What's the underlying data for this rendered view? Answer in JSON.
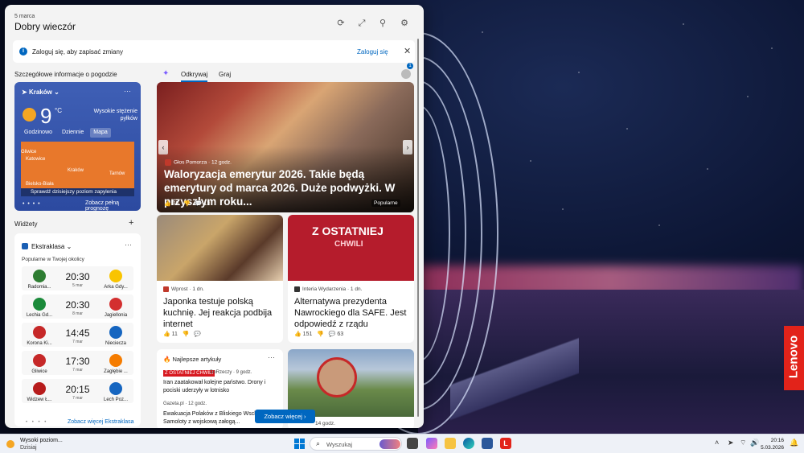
{
  "header": {
    "date": "5 marca",
    "greeting": "Dobry wieczór",
    "icons": [
      "refresh-icon",
      "expand-icon",
      "pin-icon",
      "settings-icon"
    ]
  },
  "signin_bar": {
    "message": "Zaloguj się, aby zapisać zmiany",
    "link": "Zaloguj się",
    "close": "✕"
  },
  "weather": {
    "section_title": "Szczegółowe informacje o pogodzie",
    "city": "Kraków",
    "more": "···",
    "temp": "9",
    "unit": "°C",
    "alert": "Wysokie stężenie pyłków",
    "tabs": [
      "Godzinowo",
      "Dziennie",
      "Mapa"
    ],
    "active_tab": "Mapa",
    "map_labels": [
      "Gliwice",
      "Katowice",
      "Kraków",
      "Tarnów",
      "Bielsko-Biała"
    ],
    "check_message": "Sprawdź dzisiejszy poziom zapylenia",
    "pager": "• • • •",
    "forecast_link": "Zobacz pełną prognozę"
  },
  "widgets": {
    "title": "Widżety",
    "add": "+"
  },
  "sports": {
    "name": "Ekstraklasa",
    "more": "···",
    "subtitle": "Popularne w Twojej okolicy",
    "matches": [
      {
        "home": "Radomia...",
        "away": "Arka Gdy...",
        "time": "20:30",
        "date": "5 mar",
        "home_color": "#2e7d32",
        "away_color": "#f9c400"
      },
      {
        "home": "Lechia Gd...",
        "away": "Jagiellonia",
        "time": "20:30",
        "date": "8 mar",
        "home_color": "#1b8a3a",
        "away_color": "#d32f2f"
      },
      {
        "home": "Korona Ki...",
        "away": "Nieciecza",
        "time": "14:45",
        "date": "7 mar",
        "home_color": "#c62828",
        "away_color": "#1565c0"
      },
      {
        "home": "Gliwice",
        "away": "Zagłębie ...",
        "time": "17:30",
        "date": "7 mar",
        "home_color": "#c62828",
        "away_color": "#f57c00"
      },
      {
        "home": "Widzew Ł...",
        "away": "Lech Poz...",
        "time": "20:15",
        "date": "7 mar",
        "home_color": "#b71c1c",
        "away_color": "#1565c0"
      }
    ],
    "pager": "• • • •",
    "see_more": "Zobacz więcej Ekstraklasa"
  },
  "feed": {
    "tabs": [
      "Odkrywaj",
      "Graj"
    ],
    "active_tab": "Odkrywaj",
    "notification_count": "1"
  },
  "hero": {
    "source": "Głos Pomorza · 12 godz.",
    "title": "Waloryzacja emerytur 2026. Takie będą emerytury od marca 2026. Duże podwyżki. W przyszłym roku...",
    "likes": "85",
    "comments": "13",
    "badge": "Popularne"
  },
  "cards": [
    {
      "source": "Wprost · 1 dn.",
      "title": "Japonka testuje polską kuchnię. Jej reakcja podbija internet",
      "likes": "11",
      "comments": "",
      "src_color": "#c0392b"
    },
    {
      "source": "Interia Wydarzenia · 1 dn.",
      "title": "Alternatywa prezydenta Nawrockiego dla SAFE. Jest odpowiedź z rządu",
      "likes": "151",
      "comments": "63",
      "src_color": "#333333",
      "breaking_line1": "Z OSTATNIEJ",
      "breaking_line2": "CHWILI"
    }
  ],
  "top_articles": {
    "header": "Najlepsze artykuły",
    "more": "···",
    "tag": "Z OSTATNIEJ CHWILI",
    "item1_source": "DoRzeczy · 9 godz.",
    "item1_title": "Iran zaatakował kolejne państwo. Drony i pociski uderzyły w lotnisko",
    "item2_source": "Gazeta.pl · 12 godz.",
    "item2_title": "Ewakuacja Polaków z Bliskiego Wschodu. Samoloty z wojskową załogą..."
  },
  "last_card_time": "14 godz.",
  "see_more_button": "Zobacz więcej",
  "taskbar": {
    "weather_line1": "Wysoki poziom...",
    "weather_line2": "Dzisiaj",
    "search_placeholder": "Wyszukaj",
    "time": "20:16",
    "date": "5.03.2026"
  },
  "wallpaper_brand": "Lenovo"
}
